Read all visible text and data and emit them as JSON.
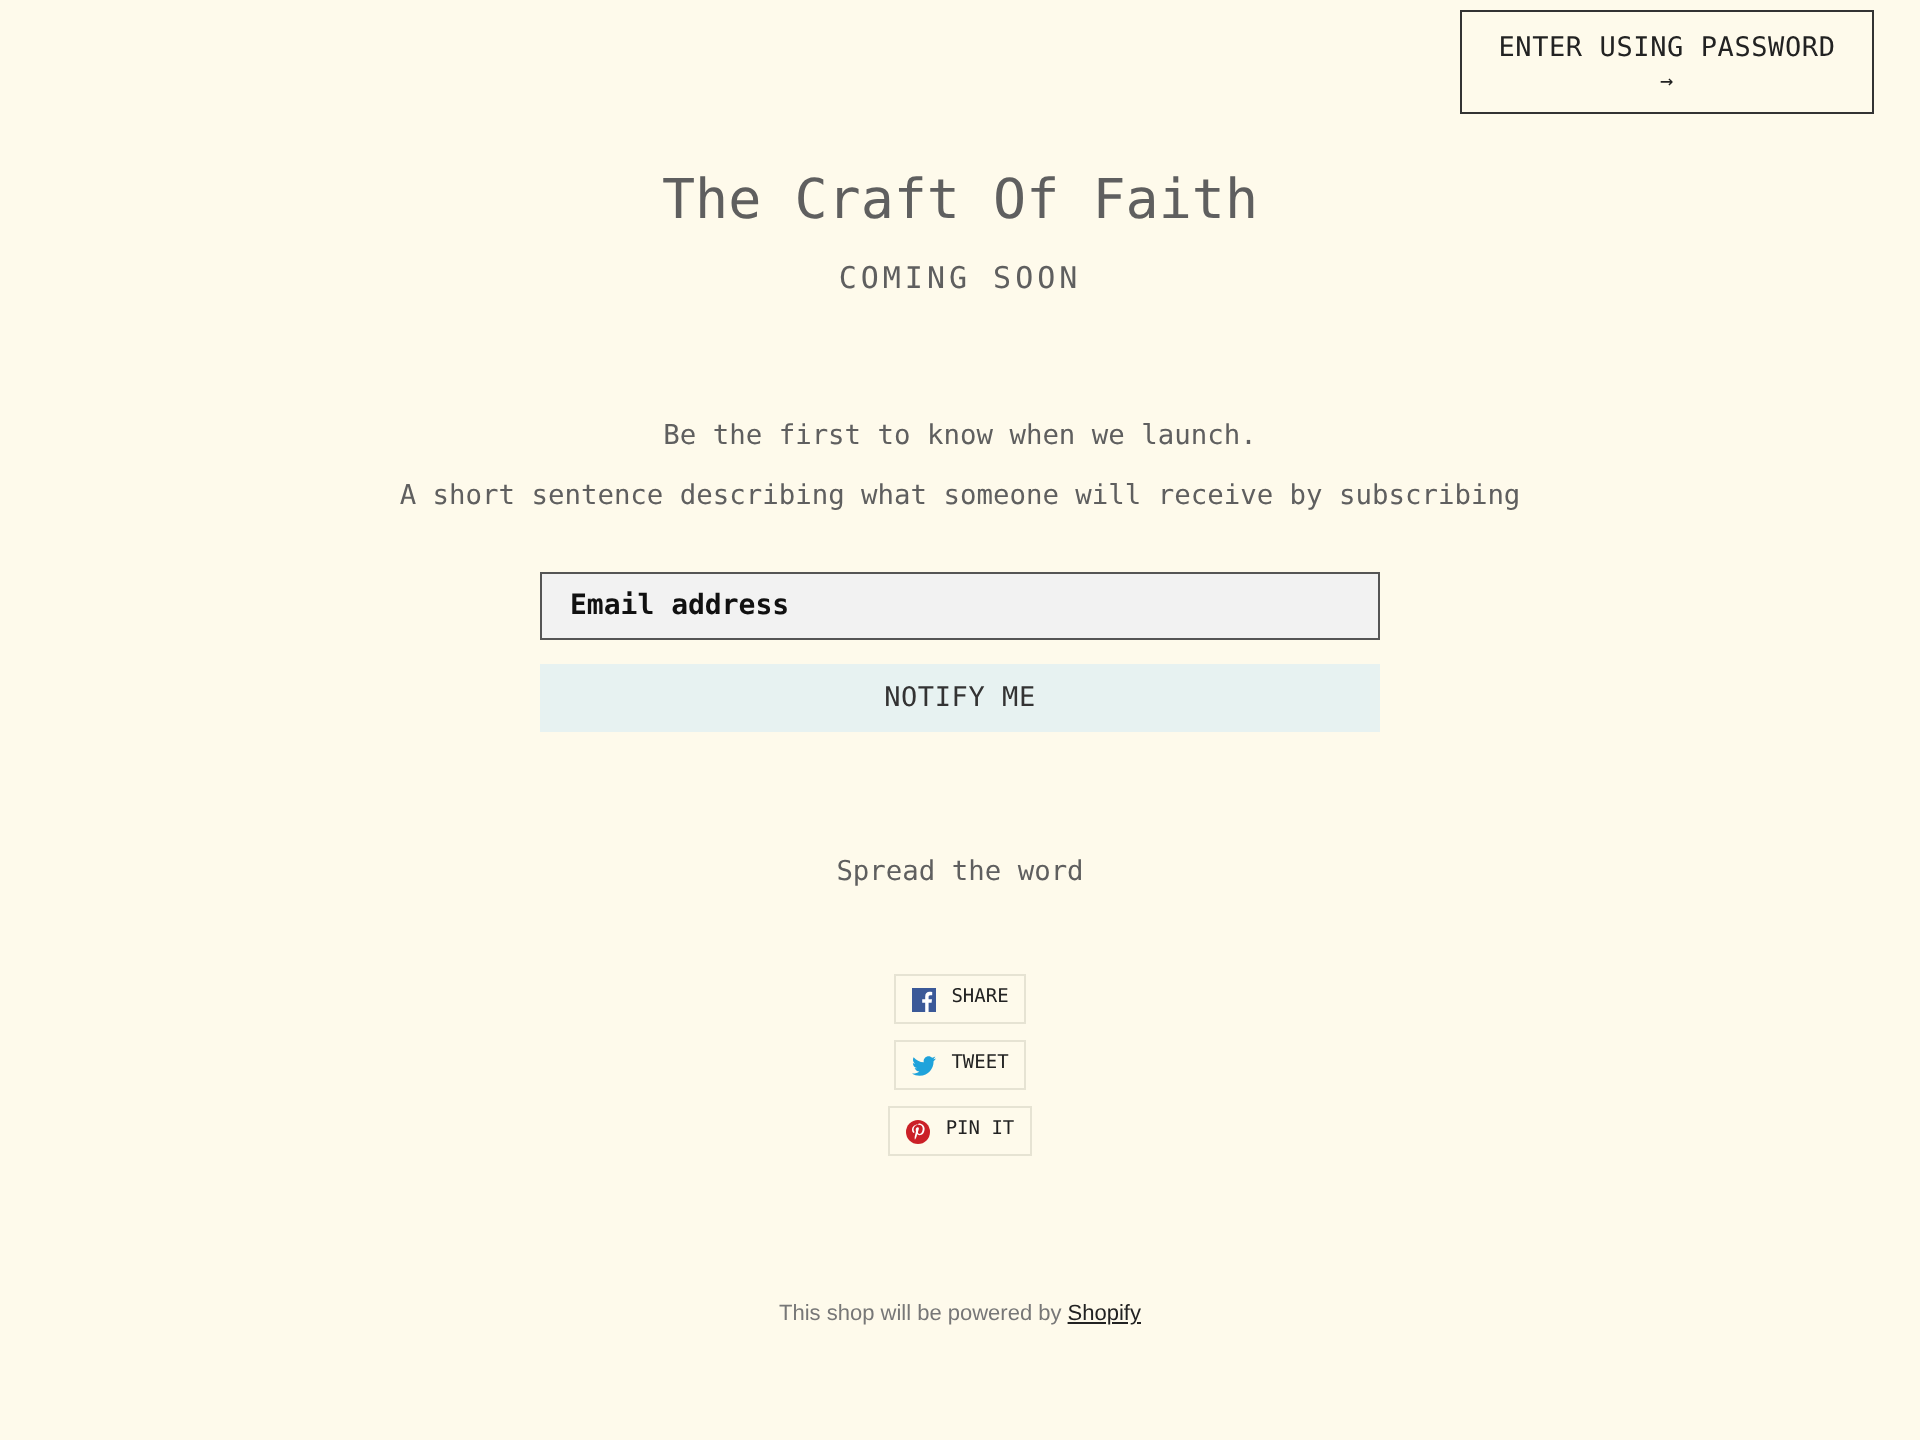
{
  "password_button": {
    "label": "ENTER USING PASSWORD",
    "arrow": "→"
  },
  "header": {
    "title": "The Craft Of Faith",
    "subtitle": "COMING SOON"
  },
  "signup": {
    "heading": "Be the first to know when we launch.",
    "description": "A short sentence describing what someone will receive by subscribing",
    "email_field": {
      "placeholder": "Email address"
    },
    "submit_button": "NOTIFY ME"
  },
  "share": {
    "heading": "Spread the word",
    "buttons": [
      {
        "kind": "facebook",
        "label": "SHARE"
      },
      {
        "kind": "twitter",
        "label": "TWEET"
      },
      {
        "kind": "pinterest",
        "label": "PIN IT"
      }
    ]
  },
  "footer": {
    "text": "This shop will be powered by",
    "link": "Shopify"
  }
}
